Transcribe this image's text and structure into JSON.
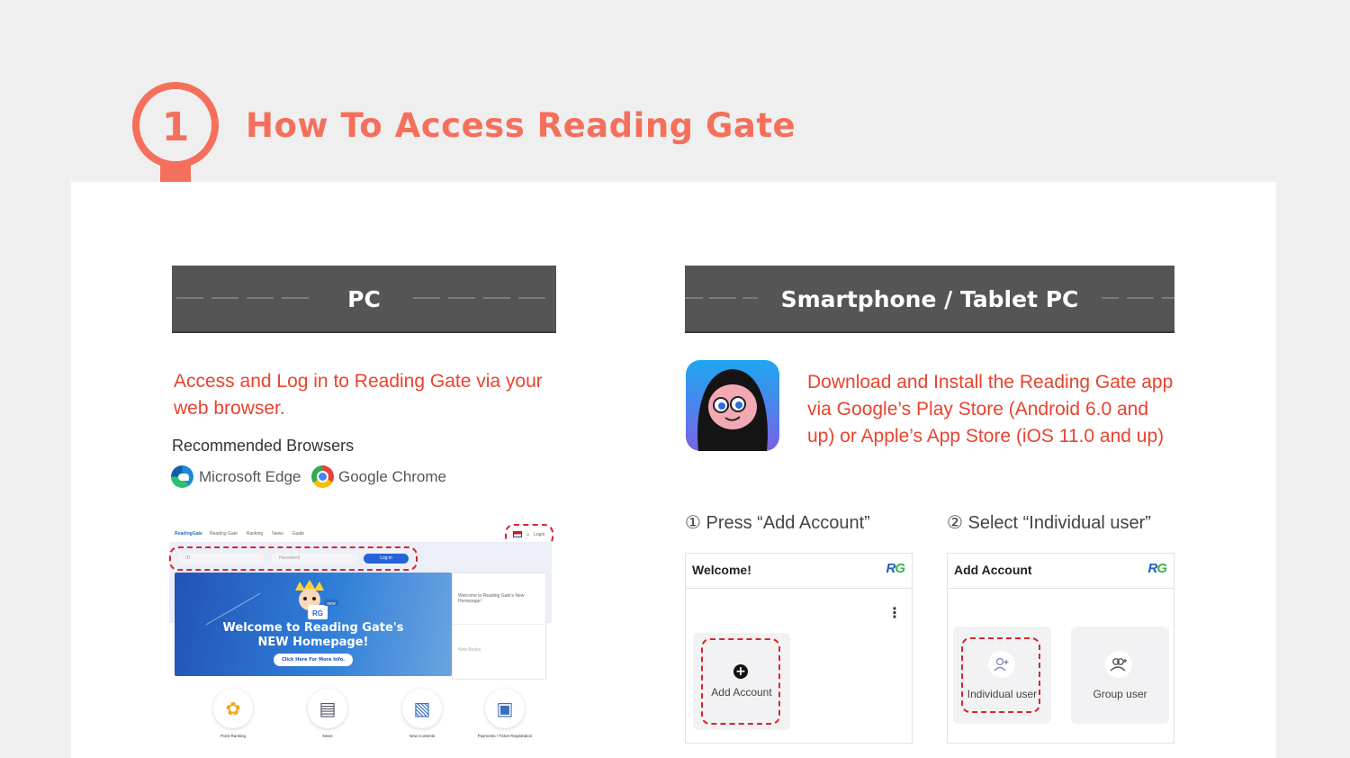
{
  "header": {
    "step_number": "1",
    "title": "How To Access Reading Gate"
  },
  "pc": {
    "bar_title": "PC",
    "description": "Access and Log in to Reading Gate via your web browser.",
    "recommended_label": "Recommended Browsers",
    "browsers": [
      {
        "name": "Microsoft Edge",
        "icon": "edge-icon"
      },
      {
        "name": "Google Chrome",
        "icon": "chrome-icon"
      }
    ],
    "mockup": {
      "logo": "ReadingGate",
      "nav": [
        "Reading Gate",
        "Ranking",
        "News",
        "Guide"
      ],
      "login_link": "Login",
      "id_placeholder": "ID",
      "password_placeholder": "Password",
      "login_button": "Log in",
      "banner_badge": "new",
      "banner_title_line1": "Welcome to Reading Gate's",
      "banner_title_line2": "NEW Homepage!",
      "banner_button": "Click Here For More Info.",
      "side_notice": "Welcome to Reading Gate's New Homepage!",
      "side_new_books": "New Books",
      "features": [
        {
          "label": "Point Ranking",
          "icon": "laurel-icon"
        },
        {
          "label": "News",
          "icon": "news-icon"
        },
        {
          "label": "New Contents",
          "icon": "books-icon"
        },
        {
          "label": "Payments / Ticket Registration",
          "icon": "payment-icon"
        }
      ]
    }
  },
  "mobile": {
    "bar_title": "Smartphone / Tablet PC",
    "description": "Download and Install the Reading Gate app via Google’s Play Store (Android 6.0 and up) or Apple’s App Store (iOS 11.0 and up)",
    "steps": [
      {
        "label": "① Press “Add Account”",
        "screen_title": "Welcome!",
        "tiles": [
          {
            "label": "Add Account",
            "icon": "plus-circle-icon"
          }
        ]
      },
      {
        "label": "② Select “Individual user”",
        "screen_title": "Add Account",
        "tiles": [
          {
            "label": "Individual user",
            "icon": "add-user-icon"
          },
          {
            "label": "Group user",
            "icon": "group-user-icon"
          }
        ]
      }
    ],
    "rg_logo_left": "R",
    "rg_logo_right": "G"
  },
  "colors": {
    "accent": "#f4705c",
    "highlight_red": "#e8432e",
    "bar_gray": "#555555",
    "dash_red": "#d8262a"
  }
}
